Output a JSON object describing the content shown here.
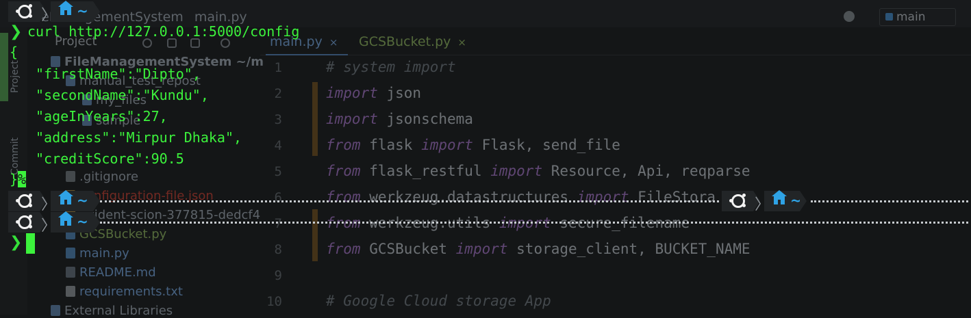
{
  "ide": {
    "breadcrumb_project": "FileManagementSystem",
    "breadcrumb_file": "main.py",
    "branch": "main",
    "left_tabs": [
      "Project",
      "Commit"
    ],
    "panel_title": "Project",
    "tree": [
      "FileManagementSystem ~/m",
      "manual_test_repost",
      "my_files",
      "sample",
      ".gitignore",
      "configuration-file.json",
      "evident-scion-377815-dedcf4",
      "GCSBucket.py",
      "main.py",
      "README.md",
      "requirements.txt",
      "External Libraries"
    ],
    "tabs": [
      "main.py",
      "GCSBucket.py"
    ],
    "line_numbers": [
      "1",
      "2",
      "3",
      "4",
      "5",
      "6",
      "7",
      "8",
      "9",
      "10"
    ],
    "code": {
      "l1": "# system import",
      "l2_kw": "import",
      "l2_rest": " json",
      "l3_kw": "import",
      "l3_rest": " jsonschema",
      "l4_kw1": "from",
      "l4_mod": " flask ",
      "l4_kw2": "import",
      "l4_rest": " Flask, send_file",
      "l5_kw1": "from",
      "l5_mod": " flask_restful ",
      "l5_kw2": "import",
      "l5_rest": " Resource, Api, reqparse",
      "l6_kw1": "from",
      "l6_mod": " werkzeug.datastructures ",
      "l6_kw2": "import",
      "l6_rest": " FileStora",
      "l7_kw1": "from",
      "l7_mod": " werkzeug.utils ",
      "l7_kw2": "import",
      "l7_rest": " secure_filename",
      "l8_kw1": "from",
      "l8_mod": " GCSBucket ",
      "l8_kw2": "import",
      "l8_rest": " storage_client, BUCKET_NAME",
      "l10": "# Google Cloud storage App"
    }
  },
  "terminal": {
    "prompt_dir": "~",
    "prompt_symbol": "❯",
    "command": "curl http://127.0.0.1:5000/config",
    "json_open": "{",
    "json_lines": [
      "\"firstName\":\"Dipto\",",
      "\"secondName\":\"Kundu\",",
      "\"ageInYears\":27,",
      "\"address\":\"Mirpur Dhaka\",",
      "\"creditScore\":90.5"
    ],
    "json_close": "}",
    "no_newline_marker": "%"
  },
  "icons": {
    "os": "ubuntu-icon",
    "dir": "home-icon",
    "separator": "chevron-right-icon"
  },
  "colors": {
    "terminal_text": "#3cf23c",
    "prompt_dir": "#2fa3e6",
    "segment_bg": "#222527",
    "background": "#141617"
  }
}
